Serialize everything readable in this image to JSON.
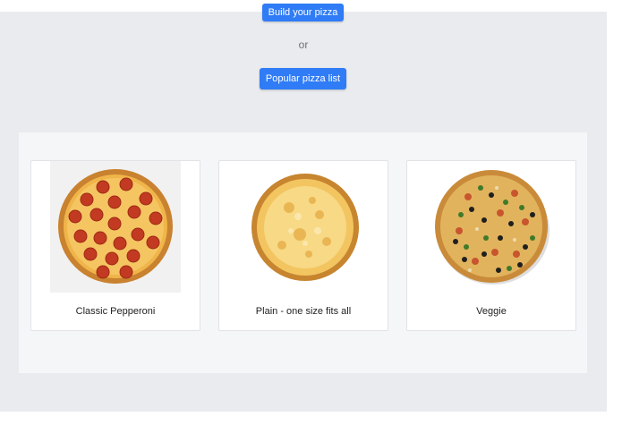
{
  "actions": {
    "build_label": "Build your pizza",
    "or_text": "or",
    "popular_label": "Popular pizza list"
  },
  "pizzas": [
    {
      "name": "Classic Pepperoni",
      "image": "pepperoni-pizza-image"
    },
    {
      "name": "Plain - one size fits all",
      "image": "cheese-pizza-image"
    },
    {
      "name": "Veggie",
      "image": "veggie-pizza-image"
    }
  ],
  "colors": {
    "primary_button": "#2f7cf6",
    "hero_background": "#eaebef",
    "panel_background": "#f5f6f8"
  }
}
